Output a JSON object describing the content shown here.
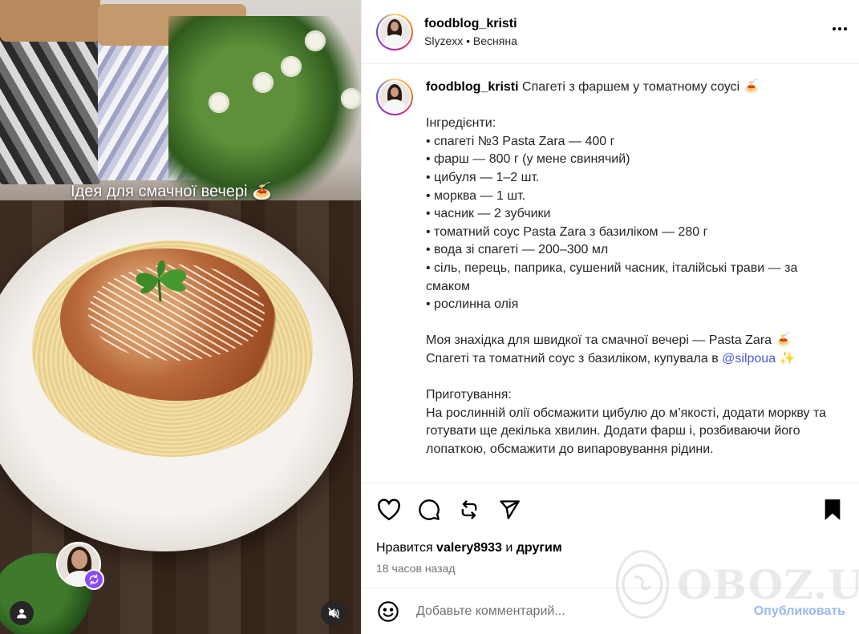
{
  "media": {
    "overlay_text": "Ідея для смачної вечері 🍝"
  },
  "header": {
    "username": "foodblog_kristi",
    "music": "Slyzexx • Весняна"
  },
  "caption": {
    "username": "foodblog_kristi",
    "title": "Спагеті з фаршем у томатному соусі 🍝",
    "ingredients_heading": "Інгредієнти:",
    "ingredients": [
      "• спагеті №3 Pasta Zara — 400 г",
      "• фарш — 800 г (у мене свинячий)",
      "• цибуля — 1–2 шт.",
      "• морква — 1 шт.",
      "• часник — 2 зубчики",
      "• томатний соус Pasta Zara з базиліком — 280 г",
      "• вода зі спагеті — 200–300 мл",
      "• сіль, перець, паприка, сушений часник, італійські трави — за смаком",
      "• рослинна олія"
    ],
    "find_line1": "Моя знахідка для швидкої та смачної вечері — Pasta Zara 🍝",
    "find_line2_prefix": "Спагеті та томатний соус з базиліком, купувала в ",
    "find_mention": "@silpoua",
    "find_line2_suffix": " ✨",
    "prep_heading": "Приготування:",
    "prep_text": "На рослинній олії обсмажити цибулю до м’якості, додати моркву та готувати ще декілька хвилин. Додати фарш і, розбиваючи його лопаткою, обсмажити до випаровування рідини."
  },
  "likes": {
    "prefix": "Нравится ",
    "user": "valery8933",
    "middle": " и ",
    "others": "другим"
  },
  "timestamp": "18 часов назад",
  "comment": {
    "placeholder": "Добавьте комментарий...",
    "publish_label": "Опубликовать"
  },
  "watermark": {
    "text": "OBOZ.UA"
  }
}
